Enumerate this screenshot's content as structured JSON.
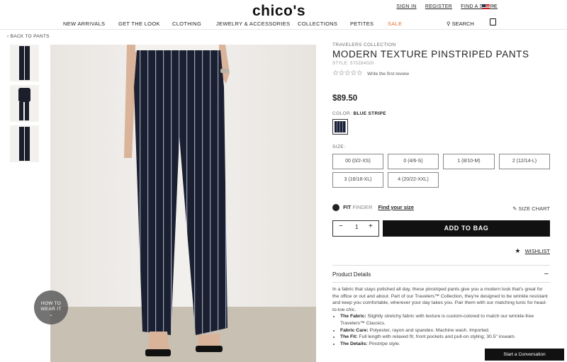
{
  "header": {
    "logo": "chico's",
    "utility": [
      "SIGN IN",
      "REGISTER",
      "FIND A STORE"
    ],
    "nav": [
      "NEW ARRIVALS",
      "GET THE LOOK",
      "CLOTHING",
      "JEWELRY & ACCESSORIES",
      "COLLECTIONS",
      "PETITES",
      "SALE"
    ],
    "search_label": "SEARCH",
    "accent_sale_color": "#e2732b"
  },
  "breadcrumb": "‹ BACK TO PANTS",
  "hero": {
    "overlay_label_1": "HOW TO",
    "overlay_label_2": "WEAR IT"
  },
  "product": {
    "collection": "TRAVELERS COLLECTION",
    "title": "MODERN TEXTURE PINSTRIPED PANTS",
    "style": "STYLE: 570284020",
    "review_link": "Write the first review",
    "stars": "☆☆☆☆☆",
    "price": "$89.50",
    "color_label": "COLOR:",
    "color_value": "BLUE STRIPE",
    "size_label": "SIZE:",
    "sizes": [
      "00 (0/2-XS)",
      "0 (4/6-S)",
      "1 (8/10-M)",
      "2 (12/14-L)",
      "3 (16/18-XL)",
      "4 (20/22-XXL)"
    ],
    "fit_bold": "FIT",
    "fit_light": "FINDER",
    "fit_link": "Find your size",
    "size_chart": "SIZE CHART",
    "qty_minus": "−",
    "qty": "1",
    "qty_plus": "+",
    "add_to_bag": "ADD TO BAG",
    "wishlist": "WISHLIST",
    "details_heading": "Product Details",
    "details_toggle": "−",
    "description": "In a fabric that stays polished all day, these pinstriped pants give you a modern look that's great for the office or out and about. Part of our Travelers™ Collection, they're designed to be wrinkle resistant and keep you comfortable, wherever your day takes you. Pair them with our matching tunic for head-to-toe chic.",
    "bullets": [
      {
        "label": "The Fabric:",
        "text": " Slightly stretchy fabric with texture is custom-colored to match our wrinkle-free Travelers™ Classics."
      },
      {
        "label": "Fabric Care:",
        "text": " Polyester, rayon and spandex. Machine wash. Imported."
      },
      {
        "label": "The Fit:",
        "text": " Full length with relaxed fit, front pockets and pull-on styling; 30.5\" inseam."
      },
      {
        "label": "The Details:",
        "text": " Pinstripe style."
      }
    ]
  },
  "chat_button": "Start a Conversation"
}
